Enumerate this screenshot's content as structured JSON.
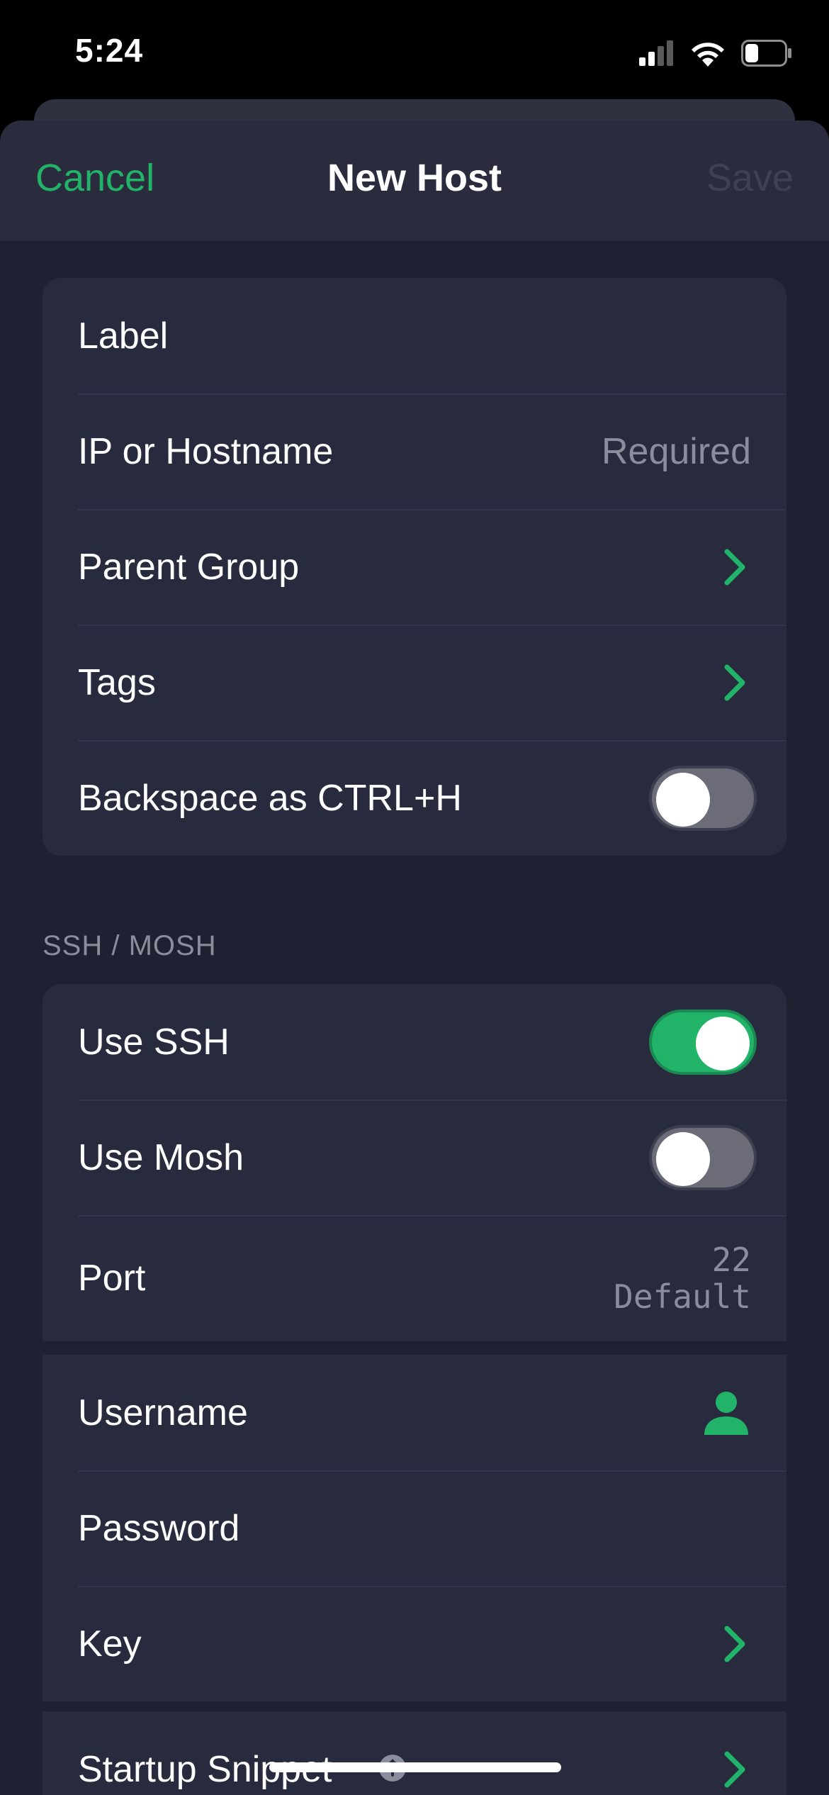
{
  "status_bar": {
    "time": "5:24"
  },
  "nav": {
    "cancel": "Cancel",
    "title": "New Host",
    "save": "Save"
  },
  "general": {
    "label": "Label",
    "host": {
      "label": "IP or Hostname",
      "placeholder": "Required"
    },
    "parent_group": "Parent Group",
    "tags": "Tags",
    "backspace": {
      "label": "Backspace as CTRL+H",
      "enabled": false
    }
  },
  "ssh_section": {
    "header": "SSH / MOSH",
    "use_ssh": {
      "label": "Use SSH",
      "enabled": true
    },
    "use_mosh": {
      "label": "Use Mosh",
      "enabled": false
    },
    "port": {
      "label": "Port",
      "value": "22",
      "hint": "Default"
    }
  },
  "credentials": {
    "username": "Username",
    "password": "Password",
    "key": "Key"
  },
  "startup": {
    "label": "Startup Snippet"
  },
  "colors": {
    "accent": "#21b469",
    "background": "#1f2132",
    "card": "#282a3d",
    "secondary_text": "#8a8d9c"
  }
}
